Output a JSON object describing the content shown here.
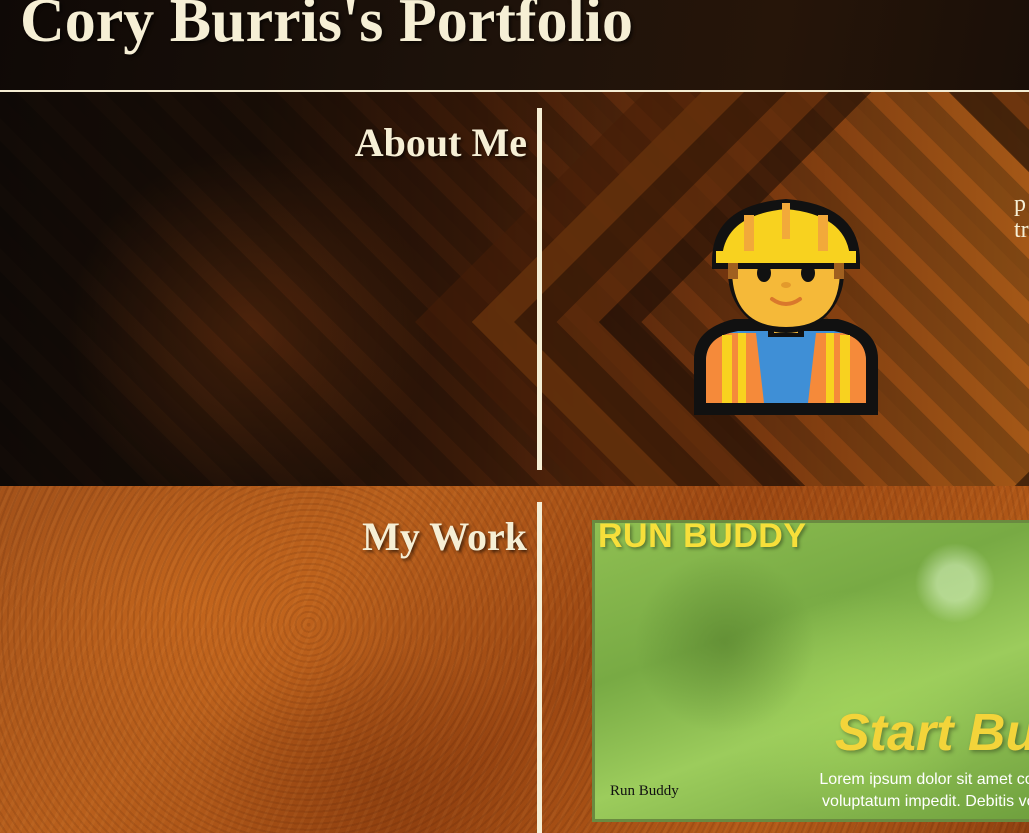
{
  "header": {
    "title": "Cory Burris's Portfolio"
  },
  "about": {
    "heading": "About Me",
    "avatar_icon": "construction-worker-icon",
    "text_line_1": "p",
    "text_line_2": "tr"
  },
  "work": {
    "heading": "My Work",
    "projects": [
      {
        "title": "RUN BUDDY",
        "hero": "Start Bu",
        "lorem_1": "Lorem ipsum dolor sit amet cons",
        "lorem_2": "voluptatum impedit. Debitis volu",
        "caption": "Run Buddy"
      }
    ]
  },
  "colors": {
    "text": "#f6efd5",
    "accent_yellow": "#f7df3a",
    "divider": "#f6efd5"
  }
}
